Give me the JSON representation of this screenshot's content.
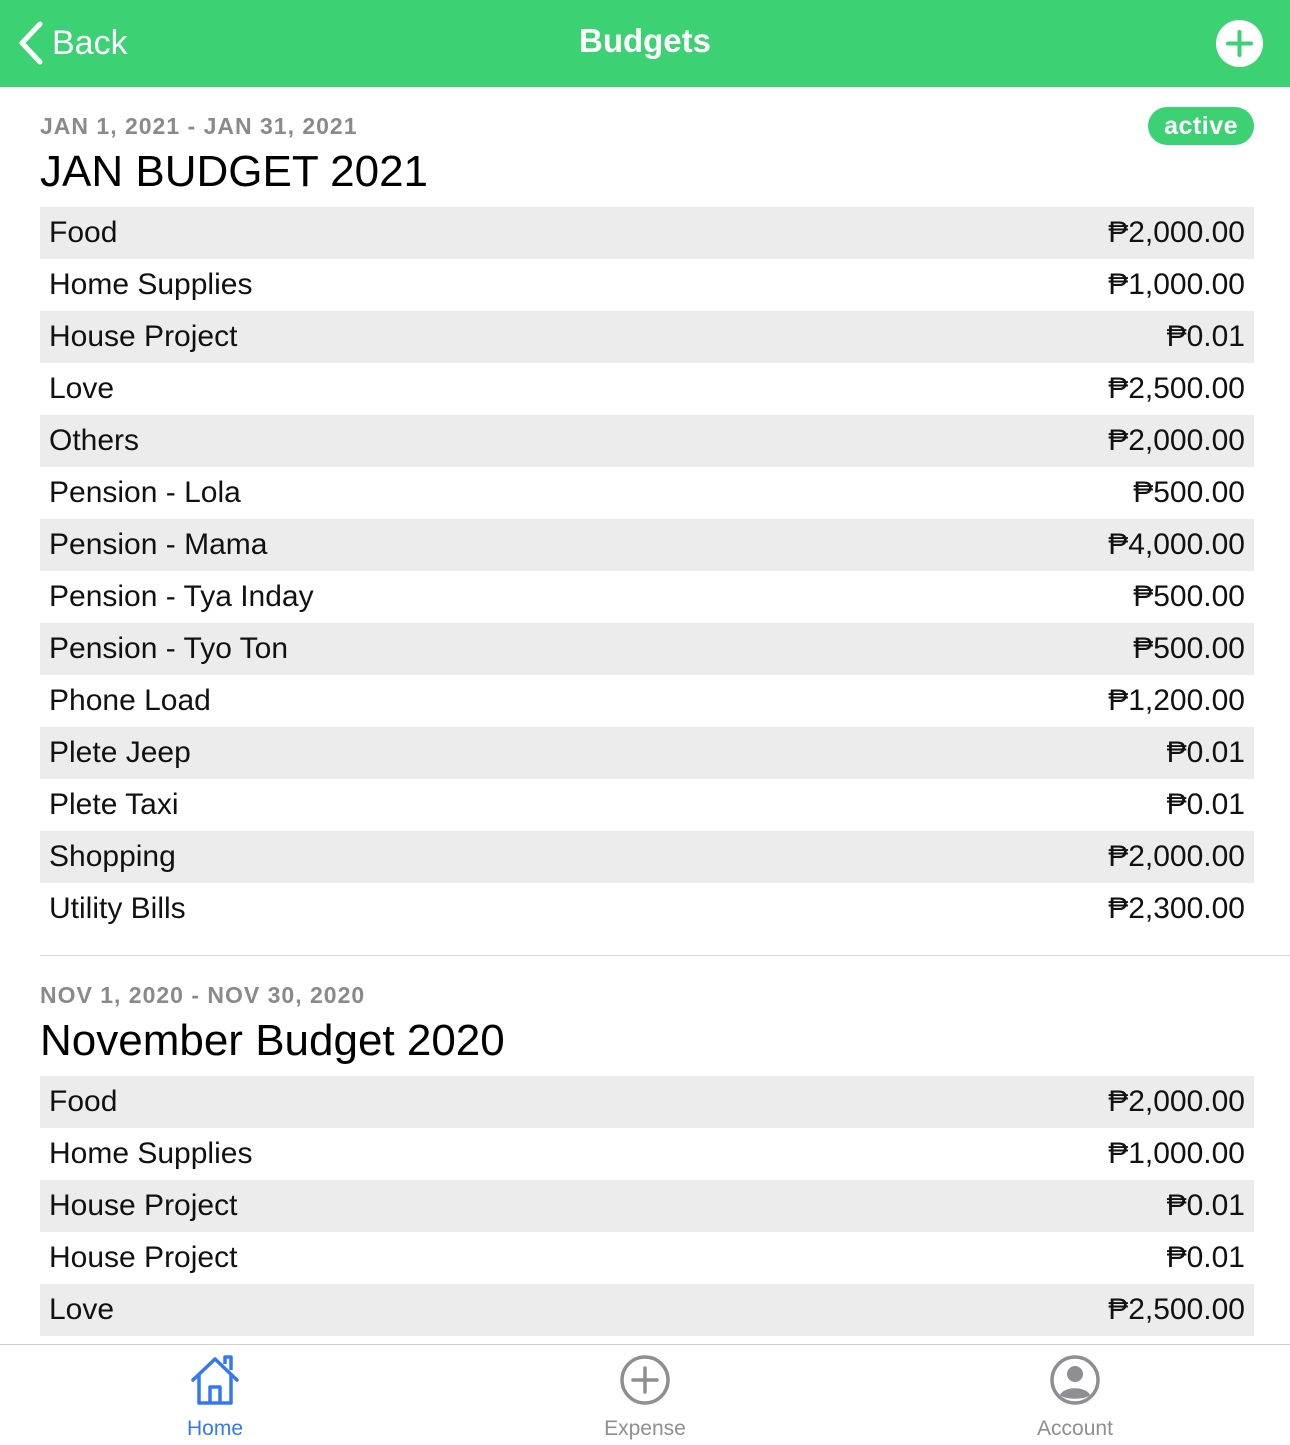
{
  "colors": {
    "accent": "#3cd274",
    "tab_active": "#3478f6",
    "tab_inactive": "#8e8e93",
    "row_shade": "#ececec"
  },
  "navbar": {
    "back_label": "Back",
    "title": "Budgets",
    "back_icon": "chevron-left-icon",
    "add_icon": "plus-circle-icon"
  },
  "budgets": [
    {
      "period": "JAN 1, 2021 - JAN 31, 2021",
      "status": "active",
      "name": "JAN BUDGET 2021",
      "items": [
        {
          "category": "Food",
          "amount": "₱2,000.00"
        },
        {
          "category": "Home Supplies",
          "amount": "₱1,000.00"
        },
        {
          "category": "House Project",
          "amount": "₱0.01"
        },
        {
          "category": "Love",
          "amount": "₱2,500.00"
        },
        {
          "category": "Others",
          "amount": "₱2,000.00"
        },
        {
          "category": "Pension - Lola",
          "amount": "₱500.00"
        },
        {
          "category": "Pension - Mama",
          "amount": "₱4,000.00"
        },
        {
          "category": "Pension - Tya Inday",
          "amount": "₱500.00"
        },
        {
          "category": "Pension - Tyo Ton",
          "amount": "₱500.00"
        },
        {
          "category": "Phone Load",
          "amount": "₱1,200.00"
        },
        {
          "category": "Plete Jeep",
          "amount": "₱0.01"
        },
        {
          "category": "Plete Taxi",
          "amount": "₱0.01"
        },
        {
          "category": "Shopping",
          "amount": "₱2,000.00"
        },
        {
          "category": "Utility Bills",
          "amount": "₱2,300.00"
        }
      ]
    },
    {
      "period": "NOV 1, 2020 - NOV 30, 2020",
      "name": "November Budget 2020",
      "items": [
        {
          "category": "Food",
          "amount": "₱2,000.00"
        },
        {
          "category": "Home Supplies",
          "amount": "₱1,000.00"
        },
        {
          "category": "House Project",
          "amount": "₱0.01"
        },
        {
          "category": "House Project",
          "amount": "₱0.01"
        },
        {
          "category": "Love",
          "amount": "₱2,500.00"
        }
      ]
    }
  ],
  "tabbar": {
    "tabs": [
      {
        "label": "Home",
        "icon": "home-icon",
        "active": true
      },
      {
        "label": "Expense",
        "icon": "plus-circle-outline-icon",
        "active": false
      },
      {
        "label": "Account",
        "icon": "user-circle-icon",
        "active": false
      }
    ]
  }
}
